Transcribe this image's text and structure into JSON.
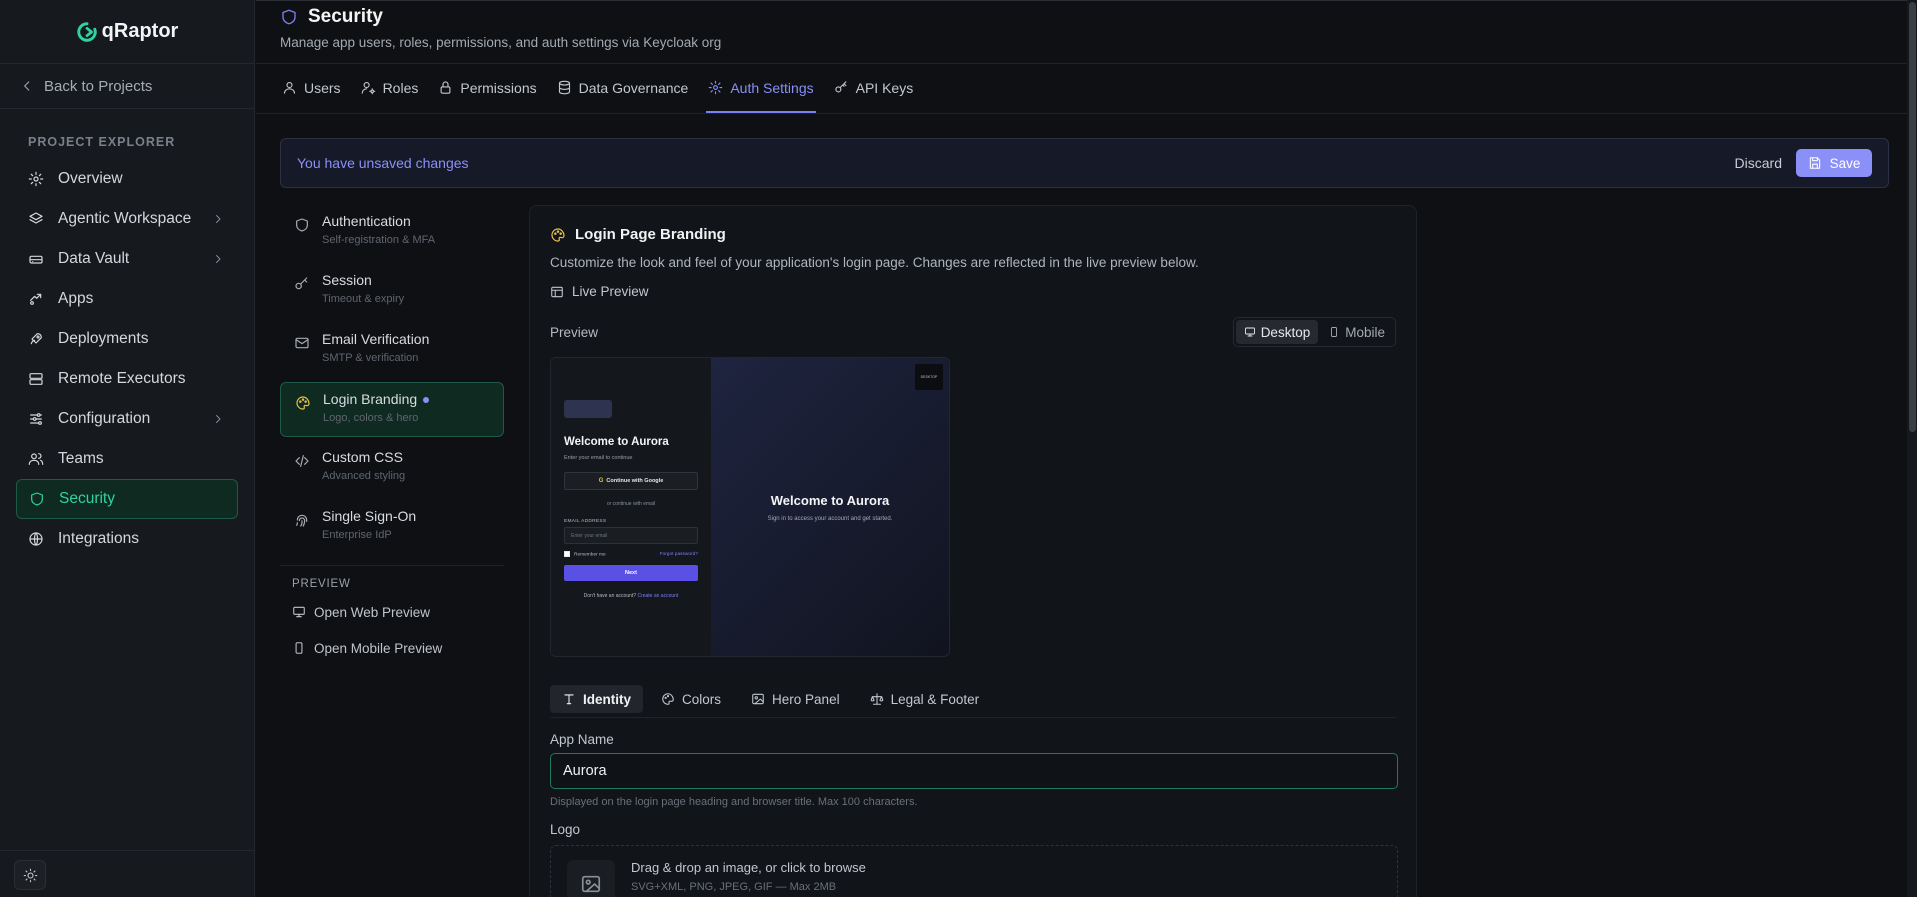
{
  "app": {
    "name": "qRaptor"
  },
  "sidebar": {
    "back_label": "Back to Projects",
    "section_label": "PROJECT EXPLORER",
    "items": [
      {
        "label": "Overview",
        "icon": "gear-icon"
      },
      {
        "label": "Agentic Workspace",
        "icon": "layers-icon"
      },
      {
        "label": "Data Vault",
        "icon": "drive-icon"
      },
      {
        "label": "Apps",
        "icon": "puzzle-icon"
      },
      {
        "label": "Deployments",
        "icon": "rocket-icon"
      },
      {
        "label": "Remote Executors",
        "icon": "server-icon"
      },
      {
        "label": "Configuration",
        "icon": "sliders-icon"
      },
      {
        "label": "Teams",
        "icon": "users-icon"
      },
      {
        "label": "Security",
        "icon": "shield-icon"
      },
      {
        "label": "Integrations",
        "icon": "globe-icon"
      }
    ],
    "active": "Security"
  },
  "header": {
    "title": "Security",
    "subtitle": "Manage app users, roles, permissions, and auth settings via Keycloak org"
  },
  "tabs": [
    {
      "label": "Users"
    },
    {
      "label": "Roles"
    },
    {
      "label": "Permissions"
    },
    {
      "label": "Data Governance"
    },
    {
      "label": "Auth Settings"
    },
    {
      "label": "API Keys"
    }
  ],
  "unsaved": {
    "message": "You have unsaved changes",
    "discard_label": "Discard",
    "save_label": "Save"
  },
  "settings_menu": {
    "items": [
      {
        "title": "Authentication",
        "subtitle": "Self-registration & MFA"
      },
      {
        "title": "Session",
        "subtitle": "Timeout & expiry"
      },
      {
        "title": "Email Verification",
        "subtitle": "SMTP & verification"
      },
      {
        "title": "Login Branding",
        "subtitle": "Logo, colors & hero"
      },
      {
        "title": "Custom CSS",
        "subtitle": "Advanced styling"
      },
      {
        "title": "Single Sign-On",
        "subtitle": "Enterprise IdP"
      }
    ],
    "preview_label": "PREVIEW",
    "open_web": "Open Web Preview",
    "open_mobile": "Open Mobile Preview"
  },
  "branding": {
    "title": "Login Page Branding",
    "description": "Customize the look and feel of your application's login page. Changes are reflected in the live preview below.",
    "live_preview_label": "Live Preview",
    "preview_label": "Preview",
    "device_desktop": "Desktop",
    "device_mobile": "Mobile",
    "mini": {
      "welcome": "Welcome to Aurora",
      "enter_email": "Enter your email to continue",
      "google_btn": "Continue with Google",
      "or_email": "or continue with email",
      "email_label": "EMAIL ADDRESS",
      "email_placeholder": "Enter your email",
      "remember": "Remember me",
      "forgot": "Forgot password?",
      "next": "Next",
      "no_account": "Don't have an account?",
      "create": "Create an account",
      "hero_title": "Welcome to Aurora",
      "hero_sub": "Sign in to access your account and get started.",
      "badge": "DESKTOP"
    },
    "subtabs": [
      {
        "label": "Identity"
      },
      {
        "label": "Colors"
      },
      {
        "label": "Hero Panel"
      },
      {
        "label": "Legal & Footer"
      }
    ],
    "app_name_label": "App Name",
    "app_name_value": "Aurora",
    "app_name_hint": "Displayed on the login page heading and browser title. Max 100 characters.",
    "logo_label": "Logo",
    "drop_title": "Drag & drop an image, or click to browse",
    "drop_sub": "SVG+XML, PNG, JPEG, GIF — Max 2MB"
  },
  "colors": {
    "accent": "#7b7ff6",
    "active_green": "#2fd3a1"
  }
}
